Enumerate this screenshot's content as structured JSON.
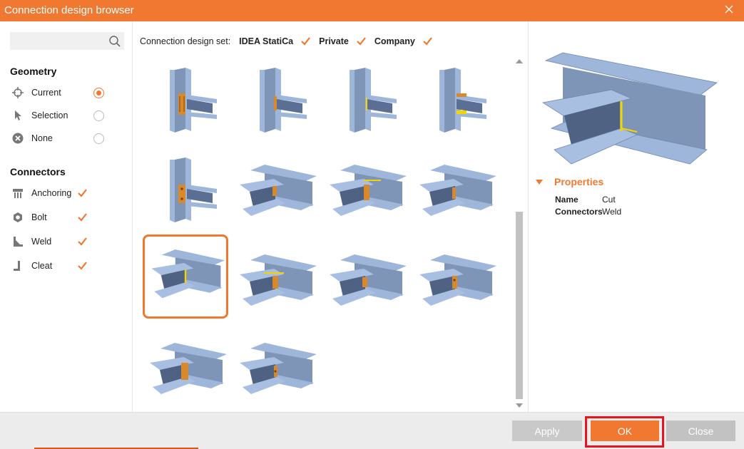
{
  "window": {
    "title": "Connection design browser",
    "close_icon": "close-icon"
  },
  "search": {
    "value": "",
    "placeholder": "",
    "icon": "search-icon"
  },
  "geometry": {
    "title": "Geometry",
    "options": [
      {
        "label": "Current",
        "icon": "crosshair-icon",
        "selected": true
      },
      {
        "label": "Selection",
        "icon": "cursor-icon",
        "selected": false
      },
      {
        "label": "None",
        "icon": "x-circle-icon",
        "selected": false
      }
    ]
  },
  "connectors": {
    "title": "Connectors",
    "items": [
      {
        "label": "Anchoring",
        "icon": "anchoring-icon",
        "checked": true
      },
      {
        "label": "Bolt",
        "icon": "bolt-icon",
        "checked": true
      },
      {
        "label": "Weld",
        "icon": "weld-icon",
        "checked": true
      },
      {
        "label": "Cleat",
        "icon": "cleat-icon",
        "checked": true
      }
    ]
  },
  "design_set": {
    "label": "Connection design set:",
    "items": [
      {
        "label": "IDEA StatiCa",
        "checked": true
      },
      {
        "label": "Private",
        "checked": true
      },
      {
        "label": "Company",
        "checked": true
      }
    ]
  },
  "thumbnails_selected_index": 8,
  "properties": {
    "title": "Properties",
    "rows": [
      {
        "key": "Name",
        "value": "Cut"
      },
      {
        "key": "Connectors",
        "value": "Weld"
      }
    ]
  },
  "buttons": {
    "apply": "Apply",
    "ok": "OK",
    "close": "Close"
  },
  "colors": {
    "accent": "#f07830",
    "steel": "#8aa6cf",
    "highlight_frame": "#e8141e"
  }
}
